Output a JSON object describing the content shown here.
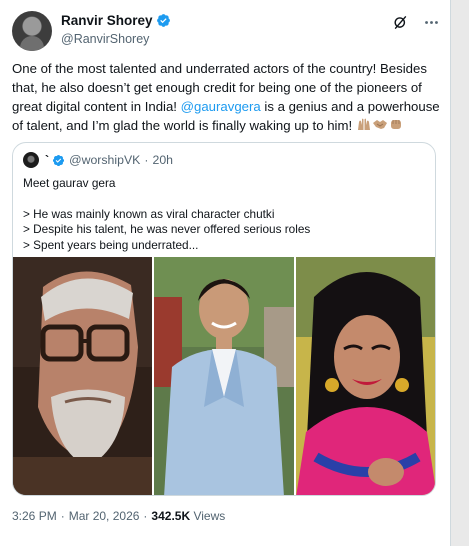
{
  "author": {
    "display_name": "Ranvir Shorey",
    "handle": "@RanvirShorey",
    "verified": true,
    "avatar_icon": "user-avatar"
  },
  "header_icons": [
    "grok-slash-icon",
    "more-icon"
  ],
  "tweet": {
    "text_before_mention": "One of the most talented and underrated actors of the country! Besides that, he also doesn’t get enough credit for being one of the pioneers of great digital content in India! ",
    "mention": "@gauravgera",
    "text_after_mention": " is a genius and a powerhouse of talent, and I’m glad the world is finally waking up to him! ",
    "emojis": [
      "raising-hands-emoji",
      "handshake-emoji",
      "fist-emoji"
    ]
  },
  "quote": {
    "display_name": "`",
    "handle": "@worshipVK",
    "separator": "·",
    "time": "20h",
    "verified": true,
    "lines": [
      "Meet gaurav gera",
      "",
      "> He was mainly known as viral character chutki",
      "> Despite his talent, he was never offered serious roles",
      "> Spent years being underrated..."
    ],
    "photos": [
      "man-with-glasses-photo",
      "man-in-blue-suit-photo",
      "character-in-costume-photo"
    ]
  },
  "meta": {
    "time": "3:26 PM",
    "separator": "·",
    "date": "Mar 20, 2026",
    "views_count": "342.5K",
    "views_label": "Views"
  },
  "colors": {
    "accent": "#1d9bf0",
    "text": "#0f1419",
    "secondary": "#536471",
    "border": "#cfd9de"
  }
}
